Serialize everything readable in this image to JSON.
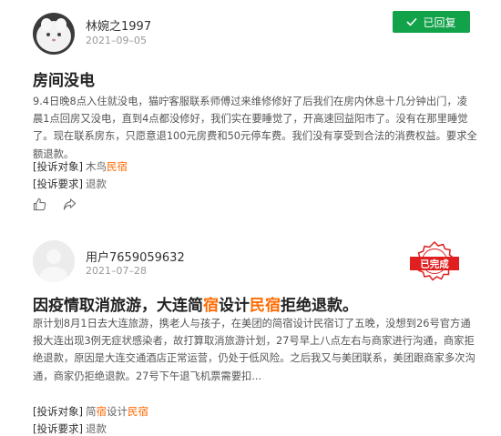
{
  "posts": [
    {
      "user": "林婉之1997",
      "date": "2021–09–05",
      "status": "已回复",
      "title": "房间没电",
      "body": "9.4日晚8点入住就没电，猫咛客服联系师傅过来维修修好了后我们在房内休息十几分钟出门，凌晨1点回房又没电，直到4点都没修好，我们实在要睡觉了，开高速回益阳市了。没有在那里睡觉了。现在联系房东，只愿意退100元房费和50元停车费。我们没有享受到合法的消费权益。要求全额退款。",
      "target_label": "[投诉对象]",
      "target_prefix": "木鸟",
      "target_highlight": "民宿",
      "demand_label": "[投诉要求]",
      "demand_value": "退款"
    },
    {
      "user": "用户7659059632",
      "date": "2021–07–28",
      "status": "已完成",
      "title_parts": [
        "因疫情取消旅游，大连简",
        "宿",
        "设计",
        "民宿",
        "拒绝退款。"
      ],
      "body": "原计划8月1日去大连旅游，携老人与孩子，在美团的简宿设计民宿订了五晚，没想到26号官方通报大连出现3例无症状感染者，故打算取消旅游计划，27号早上八点左右与商家进行沟通，商家拒绝退款，原因是大连交通酒店正常运营，仍处于低风险。之后我又与美团联系，美团跟商家多次沟通，商家仍拒绝退款。27号下午退飞机票需要扣...",
      "target_label": "[投诉对象]",
      "target_parts": [
        "简",
        "宿",
        "设计",
        "民宿"
      ],
      "demand_label": "[投诉要求]",
      "demand_value": "退款"
    }
  ],
  "icons": [
    "like-icon",
    "share-icon",
    "check-icon",
    "done-stamp-icon"
  ],
  "colors": {
    "replied_green": "#12a24a",
    "highlight_orange": "#ff6a00",
    "stamp_red": "#e02020"
  }
}
